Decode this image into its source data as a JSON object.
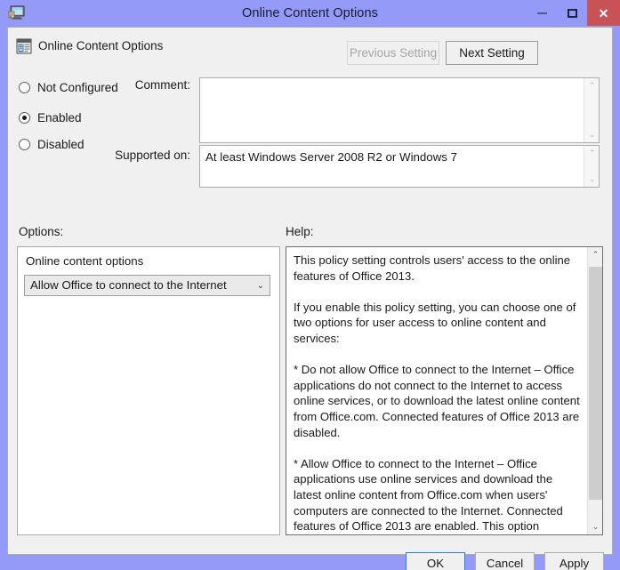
{
  "window": {
    "title": "Online Content Options",
    "app_icon": "computer-monitor-icon",
    "frame_color": "#939AF7",
    "body_color": "#F0F0F0",
    "close_button_color": "#C85356",
    "accent_focus_color": "#2A7FD4",
    "controls": {
      "minimize": "minimize-icon",
      "maximize": "maximize-icon",
      "close": "✕"
    }
  },
  "header": {
    "icon": "policy-setting-icon",
    "title": "Online Content Options",
    "previous_setting_label": "Previous Setting",
    "next_setting_label": "Next Setting",
    "previous_setting_enabled": false,
    "next_setting_enabled": true
  },
  "state": {
    "options": [
      {
        "id": "not-configured",
        "label": "Not Configured",
        "selected": false
      },
      {
        "id": "enabled",
        "label": "Enabled",
        "selected": true
      },
      {
        "id": "disabled",
        "label": "Disabled",
        "selected": false
      }
    ]
  },
  "fields": {
    "comment_label": "Comment:",
    "comment_value": "",
    "supported_on_label": "Supported on:",
    "supported_on_value": "At least Windows Server 2008 R2 or Windows 7"
  },
  "panels": {
    "options_label": "Options:",
    "help_label": "Help:"
  },
  "options_panel": {
    "group_label": "Online content options",
    "dropdown_value": "Allow Office to connect to the Internet",
    "dropdown_arrow": "⌄"
  },
  "help_panel": {
    "text": "This policy setting controls users' access to the online features of Office 2013.\n\nIf you enable this policy setting, you can choose one of two options for user access to online content and services:\n\n* Do not allow Office to connect to the Internet – Office applications do not connect to the Internet to access online services, or to download the latest online content from Office.com. Connected features of Office 2013 are disabled.\n\n* Allow Office to connect to the Internet – Office applications use online services and download the latest online content from Office.com when users' computers are connected to the Internet. Connected features of Office 2013 are enabled. This option enforces the default configuration.\n\nIf you disable this policy setting or do not configure this policy setting, Office applications use online services and download the latest online content from Office.com when users' computers are connected to the Internet. Users can change this behavior by"
  },
  "footer": {
    "ok_label": "OK",
    "cancel_label": "Cancel",
    "apply_label": "Apply"
  },
  "scrollbars": {
    "arrow_up": "⌃",
    "arrow_down": "⌄"
  }
}
